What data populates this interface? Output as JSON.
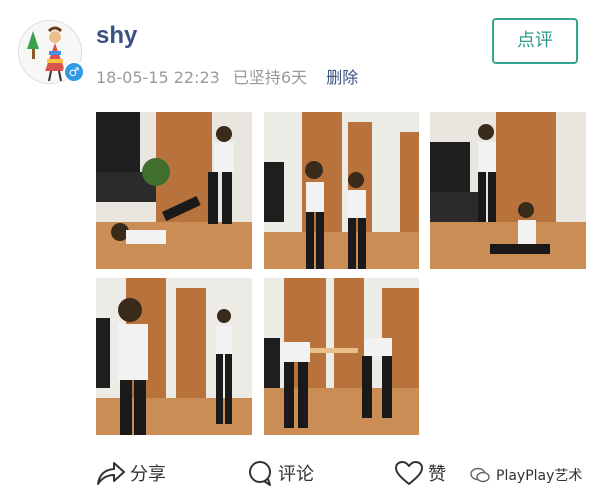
{
  "user": {
    "name": "shy",
    "gender_symbol": "♂",
    "timestamp": "18-05-15 22:23",
    "streak": "已坚持6天",
    "delete_label": "删除"
  },
  "review_button_label": "点评",
  "photos": [
    {
      "name": "photo-1"
    },
    {
      "name": "photo-2"
    },
    {
      "name": "photo-3"
    },
    {
      "name": "photo-4"
    },
    {
      "name": "photo-5"
    }
  ],
  "actions": {
    "share": "分享",
    "comment": "评论",
    "like": "赞"
  },
  "watermark": "PlayPlay艺术",
  "colors": {
    "accent": "#36a590",
    "link": "#3a4f82",
    "muted": "#9a9a9a"
  }
}
